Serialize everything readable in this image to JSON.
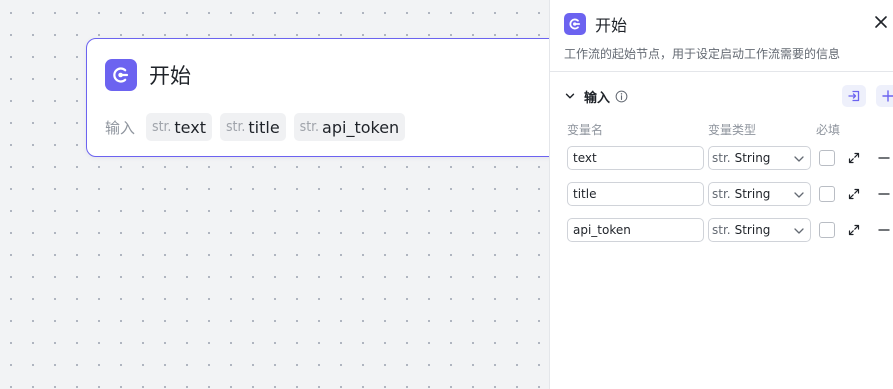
{
  "node": {
    "title": "开始",
    "inputs_label": "输入",
    "variables": [
      {
        "type": "str.",
        "name": "text"
      },
      {
        "type": "str.",
        "name": "title"
      },
      {
        "type": "str.",
        "name": "api_token"
      }
    ]
  },
  "panel": {
    "title": "开始",
    "description": "工作流的起始节点，用于设定启动工作流需要的信息",
    "section": {
      "title": "输入"
    },
    "columns": {
      "name": "变量名",
      "type": "变量类型",
      "required": "必填"
    },
    "rows": [
      {
        "name": "text",
        "type_prefix": "str.",
        "type": "String",
        "required": false
      },
      {
        "name": "title",
        "type_prefix": "str.",
        "type": "String",
        "required": false
      },
      {
        "name": "api_token",
        "type_prefix": "str.",
        "type": "String",
        "required": false
      }
    ]
  },
  "colors": {
    "accent": "#6c63f0",
    "canvas": "#f2f3f5"
  },
  "icons": [
    "start-node-icon",
    "close-icon",
    "chevron-down-icon",
    "info-icon",
    "import-icon",
    "plus-icon",
    "expand-icon",
    "minus-icon"
  ]
}
